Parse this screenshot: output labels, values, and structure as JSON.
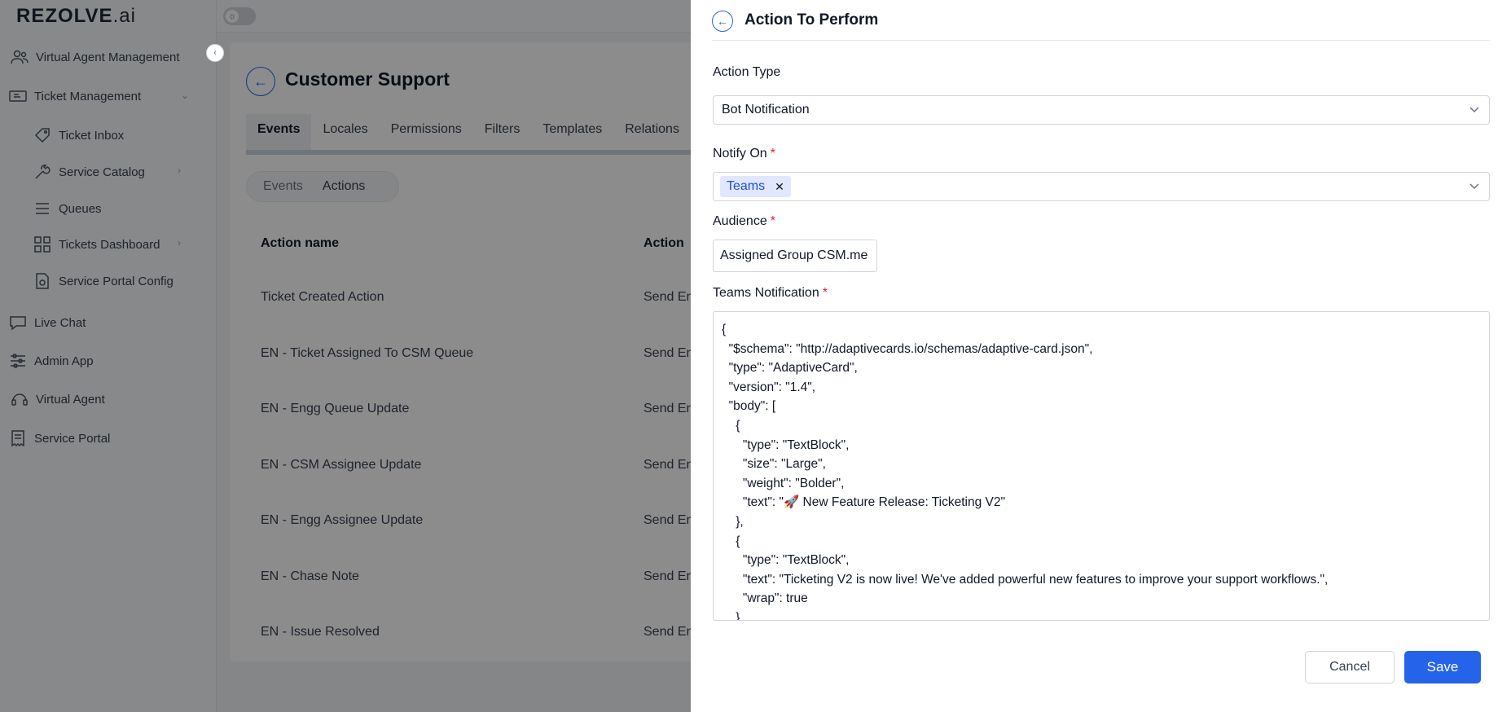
{
  "app": {
    "logo_main": "REZOLVE",
    "logo_suffix": ".ai"
  },
  "sidebar": {
    "items": [
      {
        "label": "Virtual Agent Management",
        "icon": "users-icon"
      },
      {
        "label": "Ticket Management",
        "icon": "ticket-icon"
      },
      {
        "label": "Ticket Inbox",
        "icon": "tag-icon"
      },
      {
        "label": "Service Catalog",
        "icon": "wrench-icon"
      },
      {
        "label": "Queues",
        "icon": "list-icon"
      },
      {
        "label": "Tickets Dashboard",
        "icon": "grid-icon"
      },
      {
        "label": "Service Portal Config",
        "icon": "document-gear-icon"
      },
      {
        "label": "Live Chat",
        "icon": "chat-icon"
      },
      {
        "label": "Admin App",
        "icon": "sliders-icon"
      },
      {
        "label": "Virtual Agent",
        "icon": "headset-icon"
      },
      {
        "label": "Service Portal",
        "icon": "receipt-icon"
      }
    ]
  },
  "main": {
    "title": "Customer Support",
    "tabs": [
      "Events",
      "Locales",
      "Permissions",
      "Filters",
      "Templates",
      "Relations"
    ],
    "segments": [
      "Events",
      "Actions"
    ],
    "table": {
      "headers": [
        "Action name",
        "Action"
      ],
      "rows": [
        {
          "name": "Ticket Created Action",
          "type": "Send En"
        },
        {
          "name": "EN - Ticket Assigned To CSM Queue",
          "type": "Send En"
        },
        {
          "name": "EN - Engg Queue Update",
          "type": "Send En"
        },
        {
          "name": "EN - CSM Assignee Update",
          "type": "Send En"
        },
        {
          "name": "EN - Engg Assignee Update",
          "type": "Send En"
        },
        {
          "name": "EN - Chase Note",
          "type": "Send En"
        },
        {
          "name": "EN - Issue Resolved",
          "type": "Send En"
        }
      ]
    }
  },
  "drawer": {
    "title": "Action To Perform",
    "action_type_label": "Action Type",
    "action_type_value": "Bot Notification",
    "notify_on_label": "Notify On",
    "notify_on_tag": "Teams",
    "audience_label": "Audience",
    "audience_value": "Assigned Group CSM.me",
    "teams_notification_label": "Teams Notification",
    "required_mark": "*",
    "code_lines": [
      "{",
      "  \"$schema\": \"http://adaptivecards.io/schemas/adaptive-card.json\",",
      "  \"type\": \"AdaptiveCard\",",
      "  \"version\": \"1.4\",",
      "  \"body\": [",
      "    {",
      "      \"type\": \"TextBlock\",",
      "      \"size\": \"Large\",",
      "      \"weight\": \"Bolder\",",
      "      \"text\": \"🚀 New Feature Release: Ticketing V2\"",
      "    },",
      "    {",
      "      \"type\": \"TextBlock\",",
      "      \"text\": \"Ticketing V2 is now live! We've added powerful new features to improve your support workflows.\",",
      "      \"wrap\": true",
      "    }"
    ],
    "cancel_label": "Cancel",
    "save_label": "Save"
  }
}
